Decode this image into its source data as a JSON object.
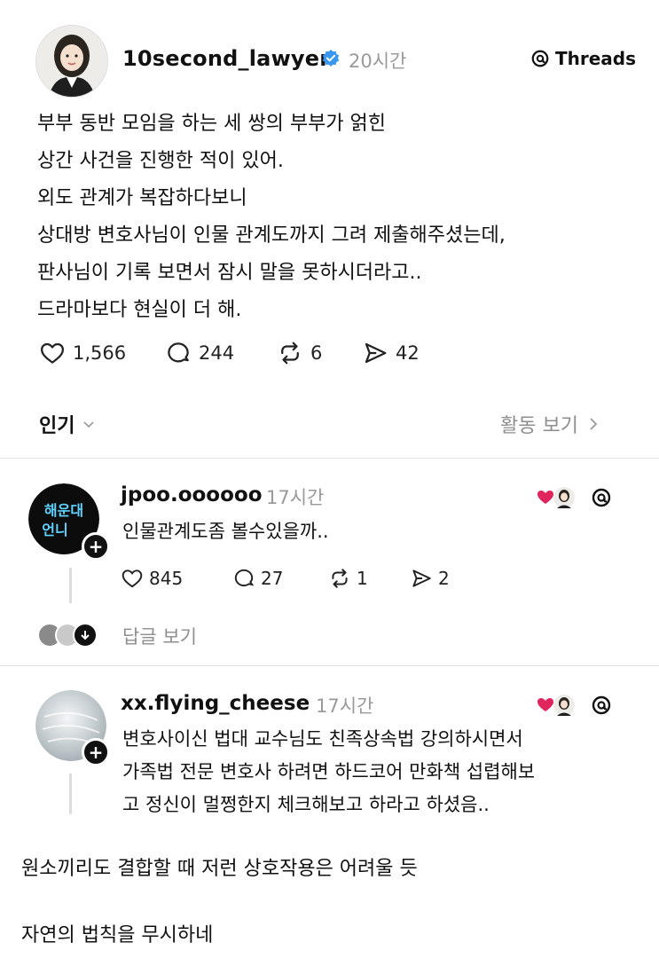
{
  "post": {
    "username": "10second_lawyer",
    "time": "20시간",
    "platform": "Threads",
    "lines": [
      "부부 동반 모임을 하는 세 쌍의 부부가 얽힌",
      "상간 사건을 진행한 적이 있어.",
      "외도 관계가 복잡하다보니",
      "상대방 변호사님이 인물 관계도까지 그려 제출해주셨는데,",
      "판사님이 기록 보면서 잠시 말을 못하시더라고..",
      "드라마보다 현실이 더 해."
    ],
    "likes": "1,566",
    "comments": "244",
    "reposts": "6",
    "shares": "42"
  },
  "filter": {
    "sort_label": "인기",
    "activity_label": "활동 보기"
  },
  "replies": [
    {
      "username": "jpoo.oooooo",
      "time": "17시간",
      "avatar_text": "해운대 언니",
      "text_lines": [
        "인물관계도좀 볼수있을까.."
      ],
      "likes": "845",
      "comments": "27",
      "reposts": "1",
      "shares": "2",
      "view_replies_label": "답글 보기"
    },
    {
      "username": "xx.flying_cheese",
      "time": "17시간",
      "text_lines": [
        "변호사이신 법대 교수님도 친족상속법 강의하시면서",
        "가족법 전문 변호사 하려면 하드코어 만화책 섭렵해보",
        "고 정신이 멀쩡한지 체크해보고 하라고 하셨음.."
      ]
    }
  ],
  "caption": {
    "line1": "원소끼리도 결합할 때 저런 상호작용은 어려울 듯",
    "line2": "자연의 법칙을 무시하네"
  },
  "colors": {
    "verified_blue": "#3897f0",
    "heart_red": "#e0245e",
    "muted_gray": "#9a9a9a"
  }
}
